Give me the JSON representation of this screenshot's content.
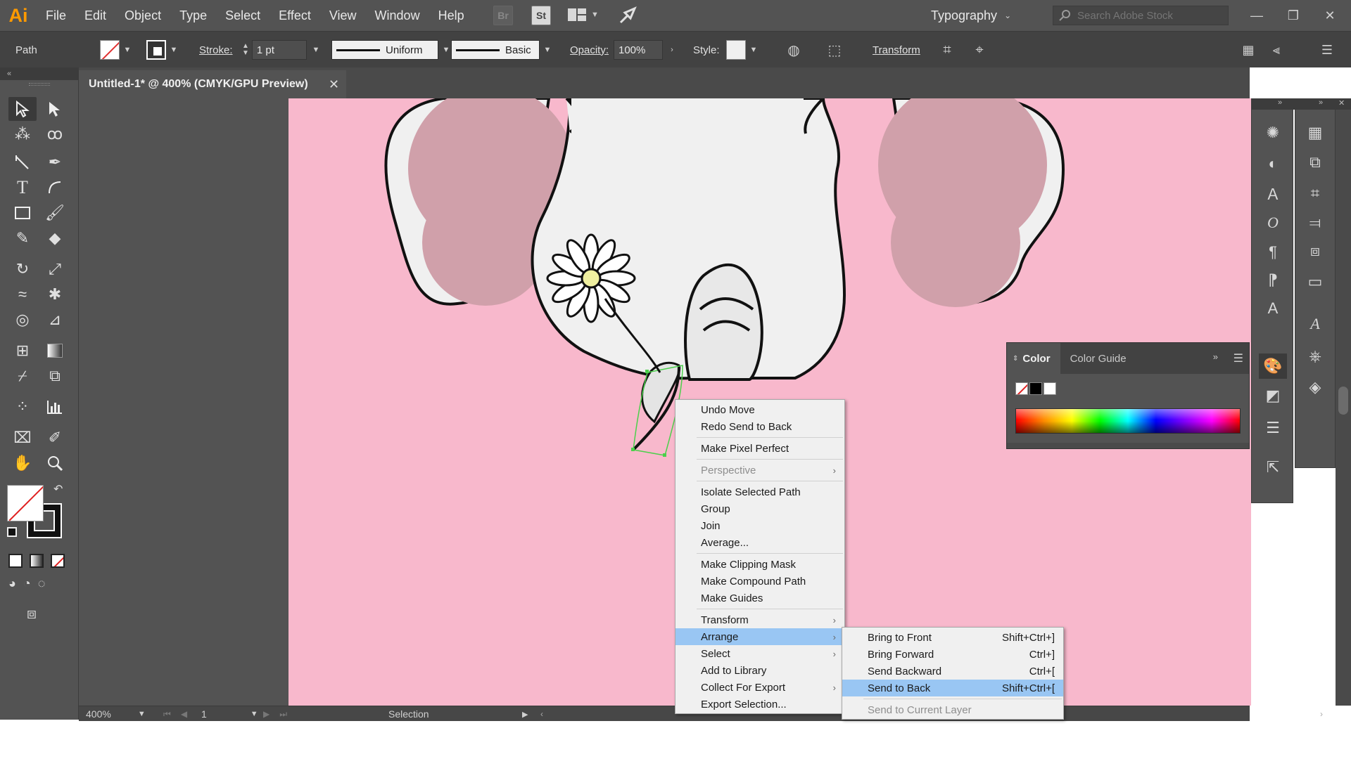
{
  "app": {
    "logo": "Ai",
    "menu": [
      "File",
      "Edit",
      "Object",
      "Type",
      "Select",
      "Effect",
      "View",
      "Window",
      "Help"
    ],
    "bridge_label": "Br",
    "stock_label": "St",
    "workspace": "Typography",
    "stock_search_placeholder": "Search Adobe Stock",
    "win_minimize": "—",
    "win_restore": "❐",
    "win_close": "✕"
  },
  "control_bar": {
    "selection_type": "Path",
    "stroke_label": "Stroke:",
    "stroke_weight": "1 pt",
    "variable_width": "Uniform",
    "brush": "Basic",
    "opacity_label": "Opacity:",
    "opacity_value": "100%",
    "style_label": "Style:",
    "transform_label": "Transform"
  },
  "document": {
    "tab_title": "Untitled-1* @ 400% (CMYK/GPU Preview)",
    "close": "✕",
    "zoom": "400%",
    "artboard_number": "1",
    "status_tool": "Selection"
  },
  "color_panel": {
    "tab_color": "Color",
    "tab_color_guide": "Color Guide"
  },
  "context_menu": {
    "items": [
      {
        "label": "Undo Move"
      },
      {
        "label": "Redo Send to Back"
      },
      {
        "label": "Make Pixel Perfect"
      },
      {
        "label": "Perspective"
      },
      {
        "label": "Isolate Selected Path"
      },
      {
        "label": "Group"
      },
      {
        "label": "Join"
      },
      {
        "label": "Average..."
      },
      {
        "label": "Make Clipping Mask"
      },
      {
        "label": "Make Compound Path"
      },
      {
        "label": "Make Guides"
      },
      {
        "label": "Transform"
      },
      {
        "label": "Arrange"
      },
      {
        "label": "Select"
      },
      {
        "label": "Add to Library"
      },
      {
        "label": "Collect For Export"
      },
      {
        "label": "Export Selection..."
      }
    ]
  },
  "arrange_submenu": {
    "items": [
      {
        "label": "Bring to Front",
        "shortcut": "Shift+Ctrl+]"
      },
      {
        "label": "Bring Forward",
        "shortcut": "Ctrl+]"
      },
      {
        "label": "Send Backward",
        "shortcut": "Ctrl+["
      },
      {
        "label": "Send to Back",
        "shortcut": "Shift+Ctrl+["
      },
      {
        "label": "Send to Current Layer",
        "shortcut": ""
      }
    ]
  },
  "colors": {
    "artboard": "#f8b8cc",
    "ear_inner": "#d0a0aa",
    "elephant_body": "#eeeeee",
    "flower_center": "#f0f0a0",
    "selection_highlight": "#99c6f3",
    "logo": "#ff9a00"
  },
  "icons": [
    "selection-tool-icon",
    "direct-selection-tool-icon",
    "magic-wand-icon",
    "lasso-icon",
    "line-segment-icon",
    "pen-icon",
    "type-icon",
    "arc-icon",
    "rectangle-icon",
    "paintbrush-icon",
    "shaper-icon",
    "eraser-icon",
    "rotate-icon",
    "scale-icon",
    "width-icon",
    "puppet-warp-icon",
    "shape-builder-icon",
    "perspective-grid-icon",
    "mesh-icon",
    "gradient-icon",
    "eyedropper-icon",
    "blend-icon",
    "symbol-sprayer-icon",
    "column-graph-icon",
    "artboard-icon",
    "slice-icon",
    "hand-icon",
    "zoom-icon"
  ]
}
